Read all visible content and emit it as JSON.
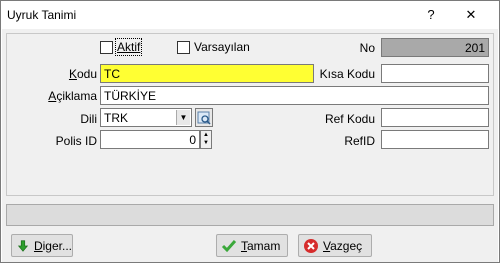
{
  "window": {
    "title": "Uyruk Tanimi",
    "help_glyph": "?",
    "close_glyph": "✕"
  },
  "form": {
    "aktif_label": "Aktif",
    "varsayilan_label": "Varsayılan",
    "no_label": "No",
    "no_value": "201",
    "kodu_label": "Kodu",
    "kodu_value": "TC",
    "kisa_kodu_label": "Kısa Kodu",
    "kisa_kodu_value": "",
    "aciklama_label": "Açiklama",
    "aciklama_value": "TÜRKİYE",
    "dili_label": "Dili",
    "dili_value": "TRK",
    "ref_kodu_label": "Ref Kodu",
    "ref_kodu_value": "",
    "polis_id_label": "Polis ID",
    "polis_id_value": "0",
    "refid_label": "RefID",
    "refid_value": ""
  },
  "buttons": {
    "diger": "Diger...",
    "tamam": "Tamam",
    "vazgec": "Vazgeç"
  },
  "colors": {
    "kodu_highlight": "#ffff33",
    "no_field_bg": "#a9a9a9",
    "diger_icon": "#2e9e2e",
    "tamam_icon": "#3aa83a",
    "vazgec_icon": "#d62c2c"
  },
  "icons": {
    "close": "close-icon",
    "help": "help-icon",
    "dropdown": "chevron-down-icon",
    "lookup": "lookup-icon",
    "diger": "arrow-down-icon",
    "tamam": "checkmark-icon",
    "vazgec": "cancel-icon"
  }
}
